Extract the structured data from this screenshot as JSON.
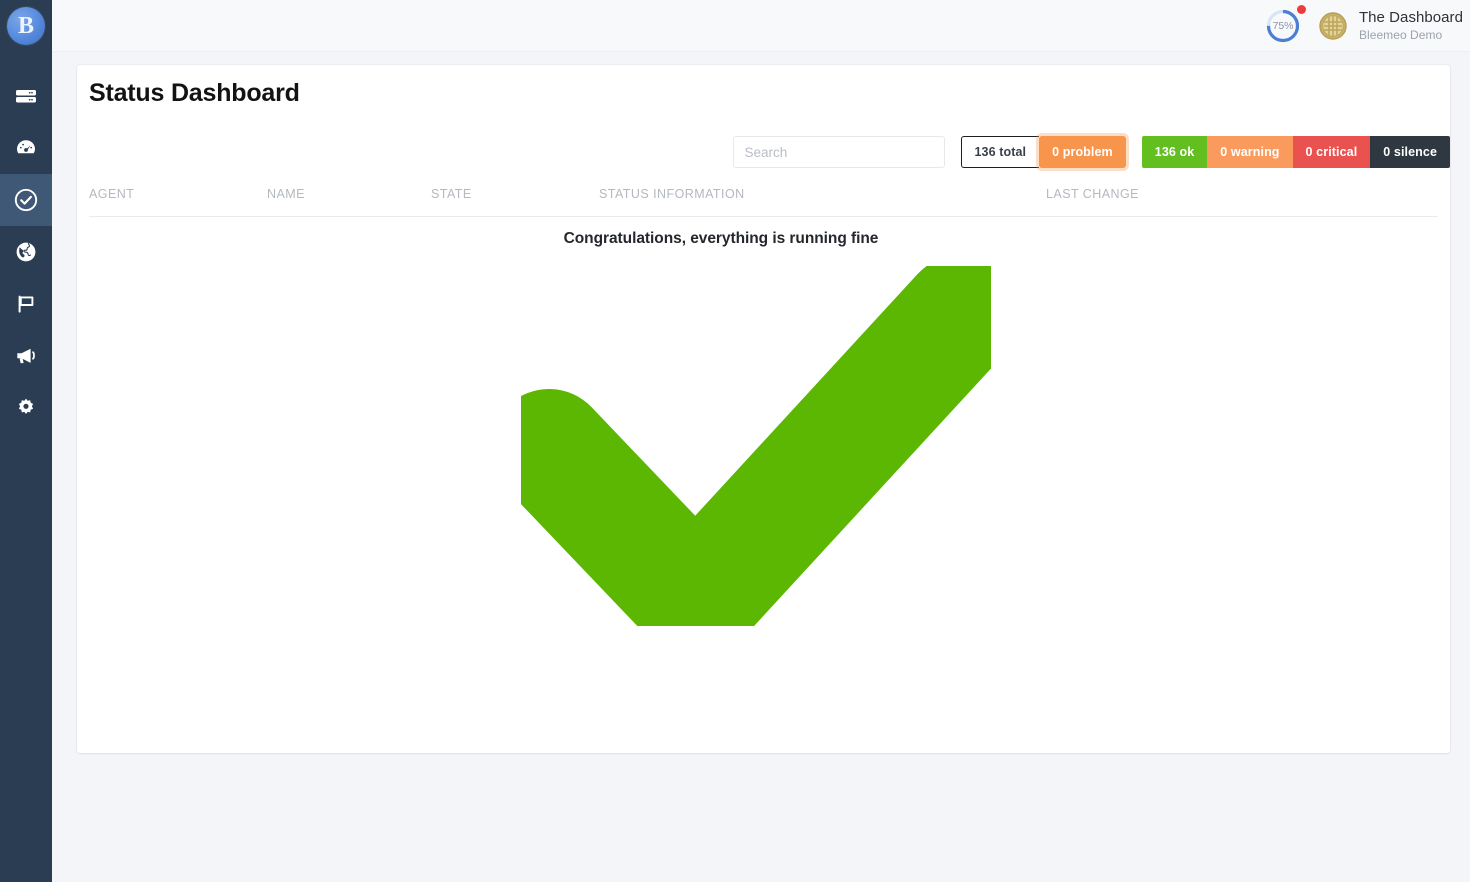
{
  "sidebar": {
    "logo": {
      "name": "bleemeo-logo",
      "letter": "B"
    },
    "items": [
      {
        "id": "servers",
        "icon": "servers-icon",
        "label": "Servers",
        "active": false
      },
      {
        "id": "dashboards",
        "icon": "gauge-icon",
        "label": "Dashboards",
        "active": false
      },
      {
        "id": "status",
        "icon": "check-circle-icon",
        "label": "Status",
        "active": true
      },
      {
        "id": "monitors",
        "icon": "globe-icon",
        "label": "Monitors",
        "active": false
      },
      {
        "id": "reports",
        "icon": "flag-icon",
        "label": "Reports",
        "active": false
      },
      {
        "id": "alerts",
        "icon": "megaphone-icon",
        "label": "Alerts",
        "active": false
      },
      {
        "id": "settings",
        "icon": "gear-icon",
        "label": "Settings",
        "active": false
      }
    ]
  },
  "header": {
    "progress": {
      "percent_label": "75%",
      "percent_value": 75,
      "ring_color": "#4a7fd4",
      "track_color": "#d7e3f7",
      "notification_dot_color": "#ef3b3b"
    },
    "account": {
      "badge_icon": "gold-badge-icon",
      "title": "The Dashboard",
      "subtitle": "Bleemeo Demo"
    }
  },
  "page": {
    "title": "Status Dashboard"
  },
  "search": {
    "placeholder": "Search",
    "value": ""
  },
  "filters": {
    "primary": [
      {
        "id": "total",
        "label": "136 total",
        "selected": false,
        "color": "#ffffff"
      },
      {
        "id": "problem",
        "label": "0 problem",
        "selected": true,
        "color": "#f7954c"
      }
    ],
    "states": [
      {
        "id": "ok",
        "label": "136 ok",
        "color": "#63bf20"
      },
      {
        "id": "warning",
        "label": "0 warning",
        "color": "#fb9a5d"
      },
      {
        "id": "critical",
        "label": "0 critical",
        "color": "#e9524f"
      },
      {
        "id": "silence",
        "label": "0 silence",
        "color": "#2f3741"
      }
    ]
  },
  "table": {
    "columns": [
      {
        "id": "agent",
        "label": "AGENT"
      },
      {
        "id": "name",
        "label": "NAME"
      },
      {
        "id": "state",
        "label": "STATE"
      },
      {
        "id": "status",
        "label": "STATUS INFORMATION"
      },
      {
        "id": "change",
        "label": "LAST CHANGE"
      }
    ],
    "rows": []
  },
  "empty_state": {
    "message": "Congratulations, everything is running fine",
    "illustration": "green-checkmark",
    "check_color": "#5cb703"
  }
}
